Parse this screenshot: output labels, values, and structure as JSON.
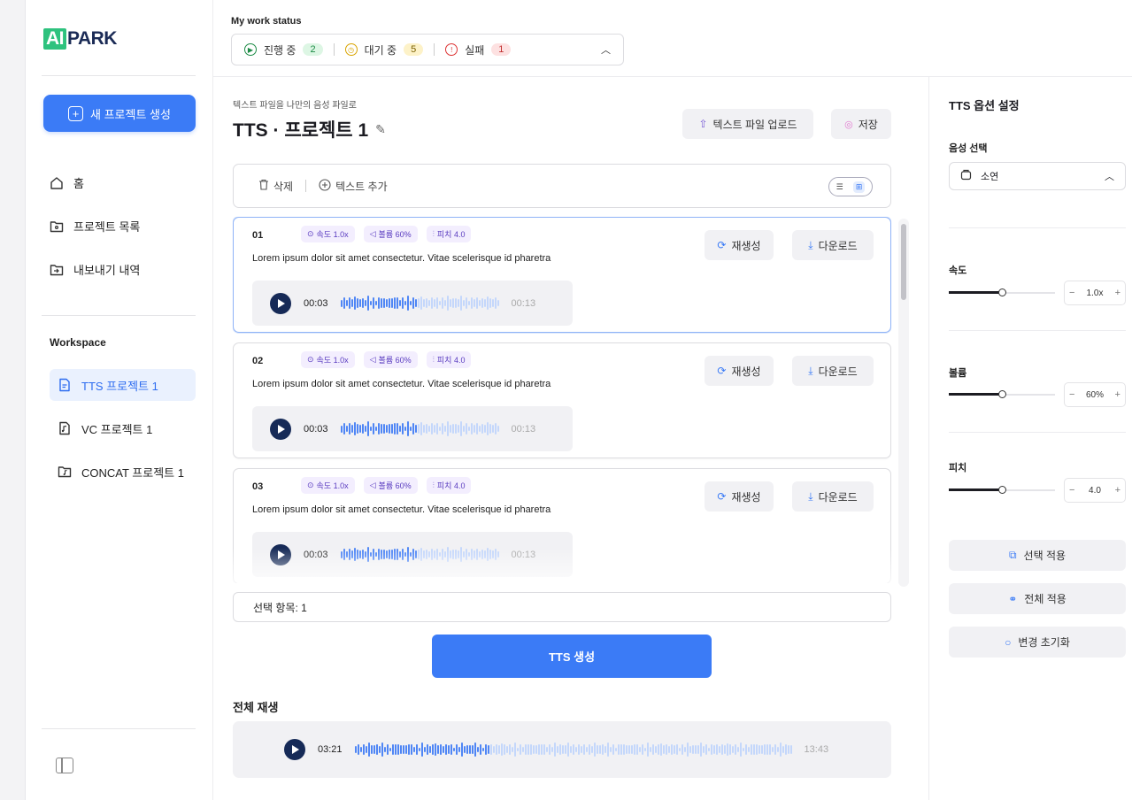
{
  "sidebar": {
    "logo_ai": "AI",
    "logo_park": "PARK",
    "new_project": "새 프로젝트 생성",
    "nav": [
      {
        "label": "홈",
        "icon": "home-icon"
      },
      {
        "label": "프로젝트 목록",
        "icon": "folder-icon"
      },
      {
        "label": "내보내기 내역",
        "icon": "export-icon"
      }
    ],
    "workspace_label": "Workspace",
    "workspace": [
      {
        "label": "TTS 프로젝트 1",
        "icon": "document-icon",
        "active": true
      },
      {
        "label": "VC 프로젝트 1",
        "icon": "audio-file-icon",
        "active": false
      },
      {
        "label": "CONCAT 프로젝트 1",
        "icon": "concat-file-icon",
        "active": false
      }
    ]
  },
  "status": {
    "title": "My work status",
    "in_progress_label": "진행 중",
    "in_progress_count": "2",
    "waiting_label": "대기 중",
    "waiting_count": "5",
    "failed_label": "실패",
    "failed_count": "1"
  },
  "main": {
    "subtitle": "텍스트 파일을 나만의 음성 파일로",
    "title": "TTS · 프로젝트 1",
    "upload_label": "텍스트 파일 업로드",
    "save_label": "저장",
    "delete_label": "삭제",
    "add_text_label": "텍스트 추가",
    "regen_label": "재생성",
    "download_label": "다운로드",
    "items": [
      {
        "num": "01",
        "speed": "속도 1.0x",
        "volume": "볼륨 60%",
        "pitch": "피치 4.0",
        "text": "Lorem ipsum dolor sit amet consectetur. Vitae scelerisque id pharetra",
        "time": "00:03",
        "end": "00:13"
      },
      {
        "num": "02",
        "speed": "속도 1.0x",
        "volume": "볼륨 60%",
        "pitch": "피치 4.0",
        "text": "Lorem ipsum dolor sit amet consectetur. Vitae scelerisque id pharetra",
        "time": "00:03",
        "end": "00:13"
      },
      {
        "num": "03",
        "speed": "속도 1.0x",
        "volume": "볼륨 60%",
        "pitch": "피치 4.0",
        "text": "Lorem ipsum dolor sit amet consectetur. Vitae scelerisque id pharetra",
        "time": "00:03",
        "end": "00:13"
      }
    ],
    "selected_label": "선택 항목: 1",
    "generate_label": "TTS 생성",
    "full_play_label": "전체 재생",
    "full_time": "03:21",
    "full_end": "13:43"
  },
  "options": {
    "title": "TTS 옵션 설정",
    "voice_label": "음성 선택",
    "voice_value": "소연",
    "speed_label": "속도",
    "speed_value": "1.0x",
    "volume_label": "볼륨",
    "volume_value": "60%",
    "pitch_label": "피치",
    "pitch_value": "4.0",
    "apply_selected": "선택 적용",
    "apply_all": "전체 적용",
    "reset": "변경 초기화"
  },
  "colors": {
    "accent": "#3b7bf6",
    "navy": "#162a57",
    "chip": "#f3eefe"
  }
}
